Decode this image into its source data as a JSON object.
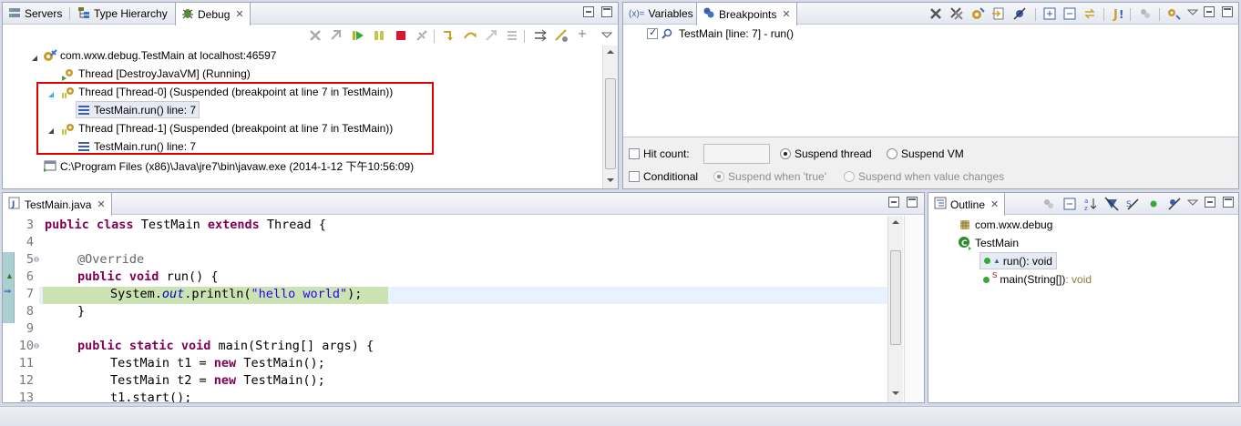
{
  "debug_view": {
    "tabs": [
      {
        "label": "Servers"
      },
      {
        "label": "Type Hierarchy"
      },
      {
        "label": "Debug",
        "close": "✕"
      }
    ],
    "tree": [
      {
        "label": "com.wxw.debug.TestMain at localhost:46597"
      },
      {
        "label": "Thread [DestroyJavaVM] (Running)"
      },
      {
        "label": "Thread [Thread-0] (Suspended (breakpoint at line 7 in TestMain))"
      },
      {
        "label": "TestMain.run() line: 7"
      },
      {
        "label": "Thread [Thread-1] (Suspended (breakpoint at line 7 in TestMain))"
      },
      {
        "label": "TestMain.run() line: 7"
      },
      {
        "label": "C:\\Program Files (x86)\\Java\\jre7\\bin\\javaw.exe (2014-1-12 下午10:56:09)"
      }
    ]
  },
  "breakpoints_view": {
    "tabs": [
      {
        "label": "Variables"
      },
      {
        "label": "Breakpoints",
        "close": "✕"
      }
    ],
    "items": [
      {
        "label": "TestMain [line: 7] - run()",
        "checked": true
      }
    ],
    "hit_count_label": "Hit count:",
    "suspend_thread_label": "Suspend thread",
    "suspend_vm_label": "Suspend VM",
    "conditional_label": "Conditional",
    "suspend_true_label": "Suspend when 'true'",
    "suspend_changes_label": "Suspend when value changes"
  },
  "editor": {
    "tab": {
      "label": "TestMain.java",
      "close": "✕"
    },
    "lines": [
      {
        "num": "3"
      },
      {
        "num": "4"
      },
      {
        "num": "5",
        "fold": "⊖"
      },
      {
        "num": "6"
      },
      {
        "num": "7"
      },
      {
        "num": "8"
      },
      {
        "num": "9"
      },
      {
        "num": "10",
        "fold": "⊖"
      },
      {
        "num": "11"
      },
      {
        "num": "12"
      },
      {
        "num": "13"
      }
    ],
    "tokens": {
      "public": "public",
      "class": "class",
      "extends": "extends",
      "void": "void",
      "static": "static",
      "new": "new",
      "class_name": " TestMain ",
      "superclass": " Thread {",
      "override": "@Override",
      "run_sig": " run() {",
      "sysout_prefix": "System.",
      "out_field": "out",
      "println_open": ".println(",
      "hello": "\"hello world\"",
      "println_close": ");",
      "close_brace": "}",
      "main_sig": " main(String[] args) {",
      "t1_decl": "TestMain t1 = ",
      "t2_decl": "TestMain t2 = ",
      "ctor_call": " TestMain();",
      "t1_start": "t1.start();"
    }
  },
  "outline": {
    "tab": {
      "label": "Outline",
      "close": "✕"
    },
    "items": [
      {
        "label": "com.wxw.debug"
      },
      {
        "label": "TestMain"
      },
      {
        "label": "run()",
        "type": " : void"
      },
      {
        "label": "main(String[])",
        "type": " : void"
      }
    ]
  },
  "colors": {
    "highlight_box": "#e00000",
    "current_line": "#cbe3b2",
    "keyword": "#7f0055",
    "string": "#2a00ff"
  }
}
